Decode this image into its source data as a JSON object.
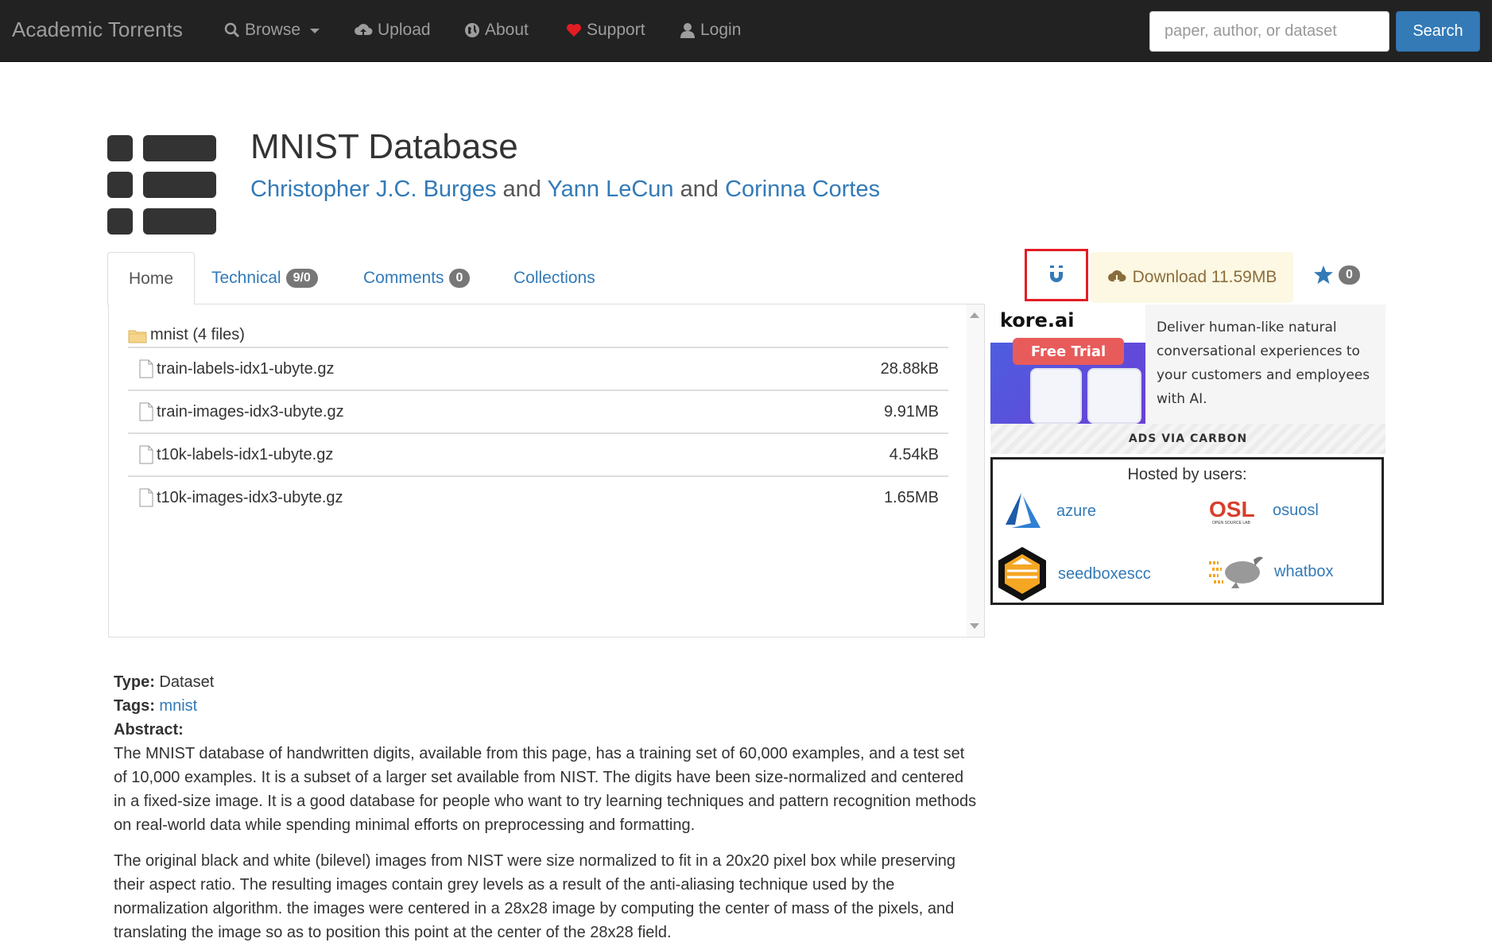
{
  "navbar": {
    "brand": "Academic Torrents",
    "browse": "Browse",
    "upload": "Upload",
    "about": "About",
    "support": "Support",
    "login": "Login",
    "search_placeholder": "paper, author, or dataset",
    "search_button": "Search",
    "support_icon_color": "#e31c23"
  },
  "dataset": {
    "title": "MNIST Database",
    "authors": [
      "Christopher J.C. Burges",
      "Yann LeCun",
      "Corinna Cortes"
    ],
    "and": "and"
  },
  "tabs": [
    {
      "label": "Home",
      "active": true
    },
    {
      "label": "Technical",
      "badge": "9/0"
    },
    {
      "label": "Comments",
      "badge": "0"
    },
    {
      "label": "Collections"
    }
  ],
  "actions": {
    "download": "Download 11.59MB",
    "star_count": "0"
  },
  "files": {
    "folder": "mnist (4 files)",
    "items": [
      {
        "name": "train-labels-idx1-ubyte.gz",
        "size": "28.88kB"
      },
      {
        "name": "train-images-idx3-ubyte.gz",
        "size": "9.91MB"
      },
      {
        "name": "t10k-labels-idx1-ubyte.gz",
        "size": "4.54kB"
      },
      {
        "name": "t10k-images-idx3-ubyte.gz",
        "size": "1.65MB"
      }
    ]
  },
  "ad": {
    "brand": "kore.ai",
    "cta": "Free Trial",
    "text": "Deliver human-like natural conversational experiences to your customers and employees with AI.",
    "via": "ADS VIA CARBON"
  },
  "hosted": {
    "title": "Hosted by users:",
    "hosts": [
      "azure",
      "osuosl",
      "seedboxescc",
      "whatbox"
    ],
    "osl_logo": "OSL",
    "osl_sub": "OPEN SOURCE LAB"
  },
  "details": {
    "type_label": "Type:",
    "type_value": "Dataset",
    "tags_label": "Tags:",
    "tag": "mnist",
    "abstract_label": "Abstract:",
    "abstract_p1": "The MNIST database of handwritten digits, available from this page, has a training set of 60,000 examples, and a test set of 10,000 examples. It is a subset of a larger set available from NIST. The digits have been size-normalized and centered in a fixed-size image. It is a good database for people who want to try learning techniques and pattern recognition methods on real-world data while spending minimal efforts on preprocessing and formatting.",
    "abstract_p2": "The original black and white (bilevel) images from NIST were size normalized to fit in a 20x20 pixel box while preserving their aspect ratio. The resulting images contain grey levels as a result of the anti-aliasing technique used by the normalization algorithm. the images were centered in a 28x28 image by computing the center of mass of the pixels, and translating the image so as to position this point at the center of the 28x28 field."
  }
}
